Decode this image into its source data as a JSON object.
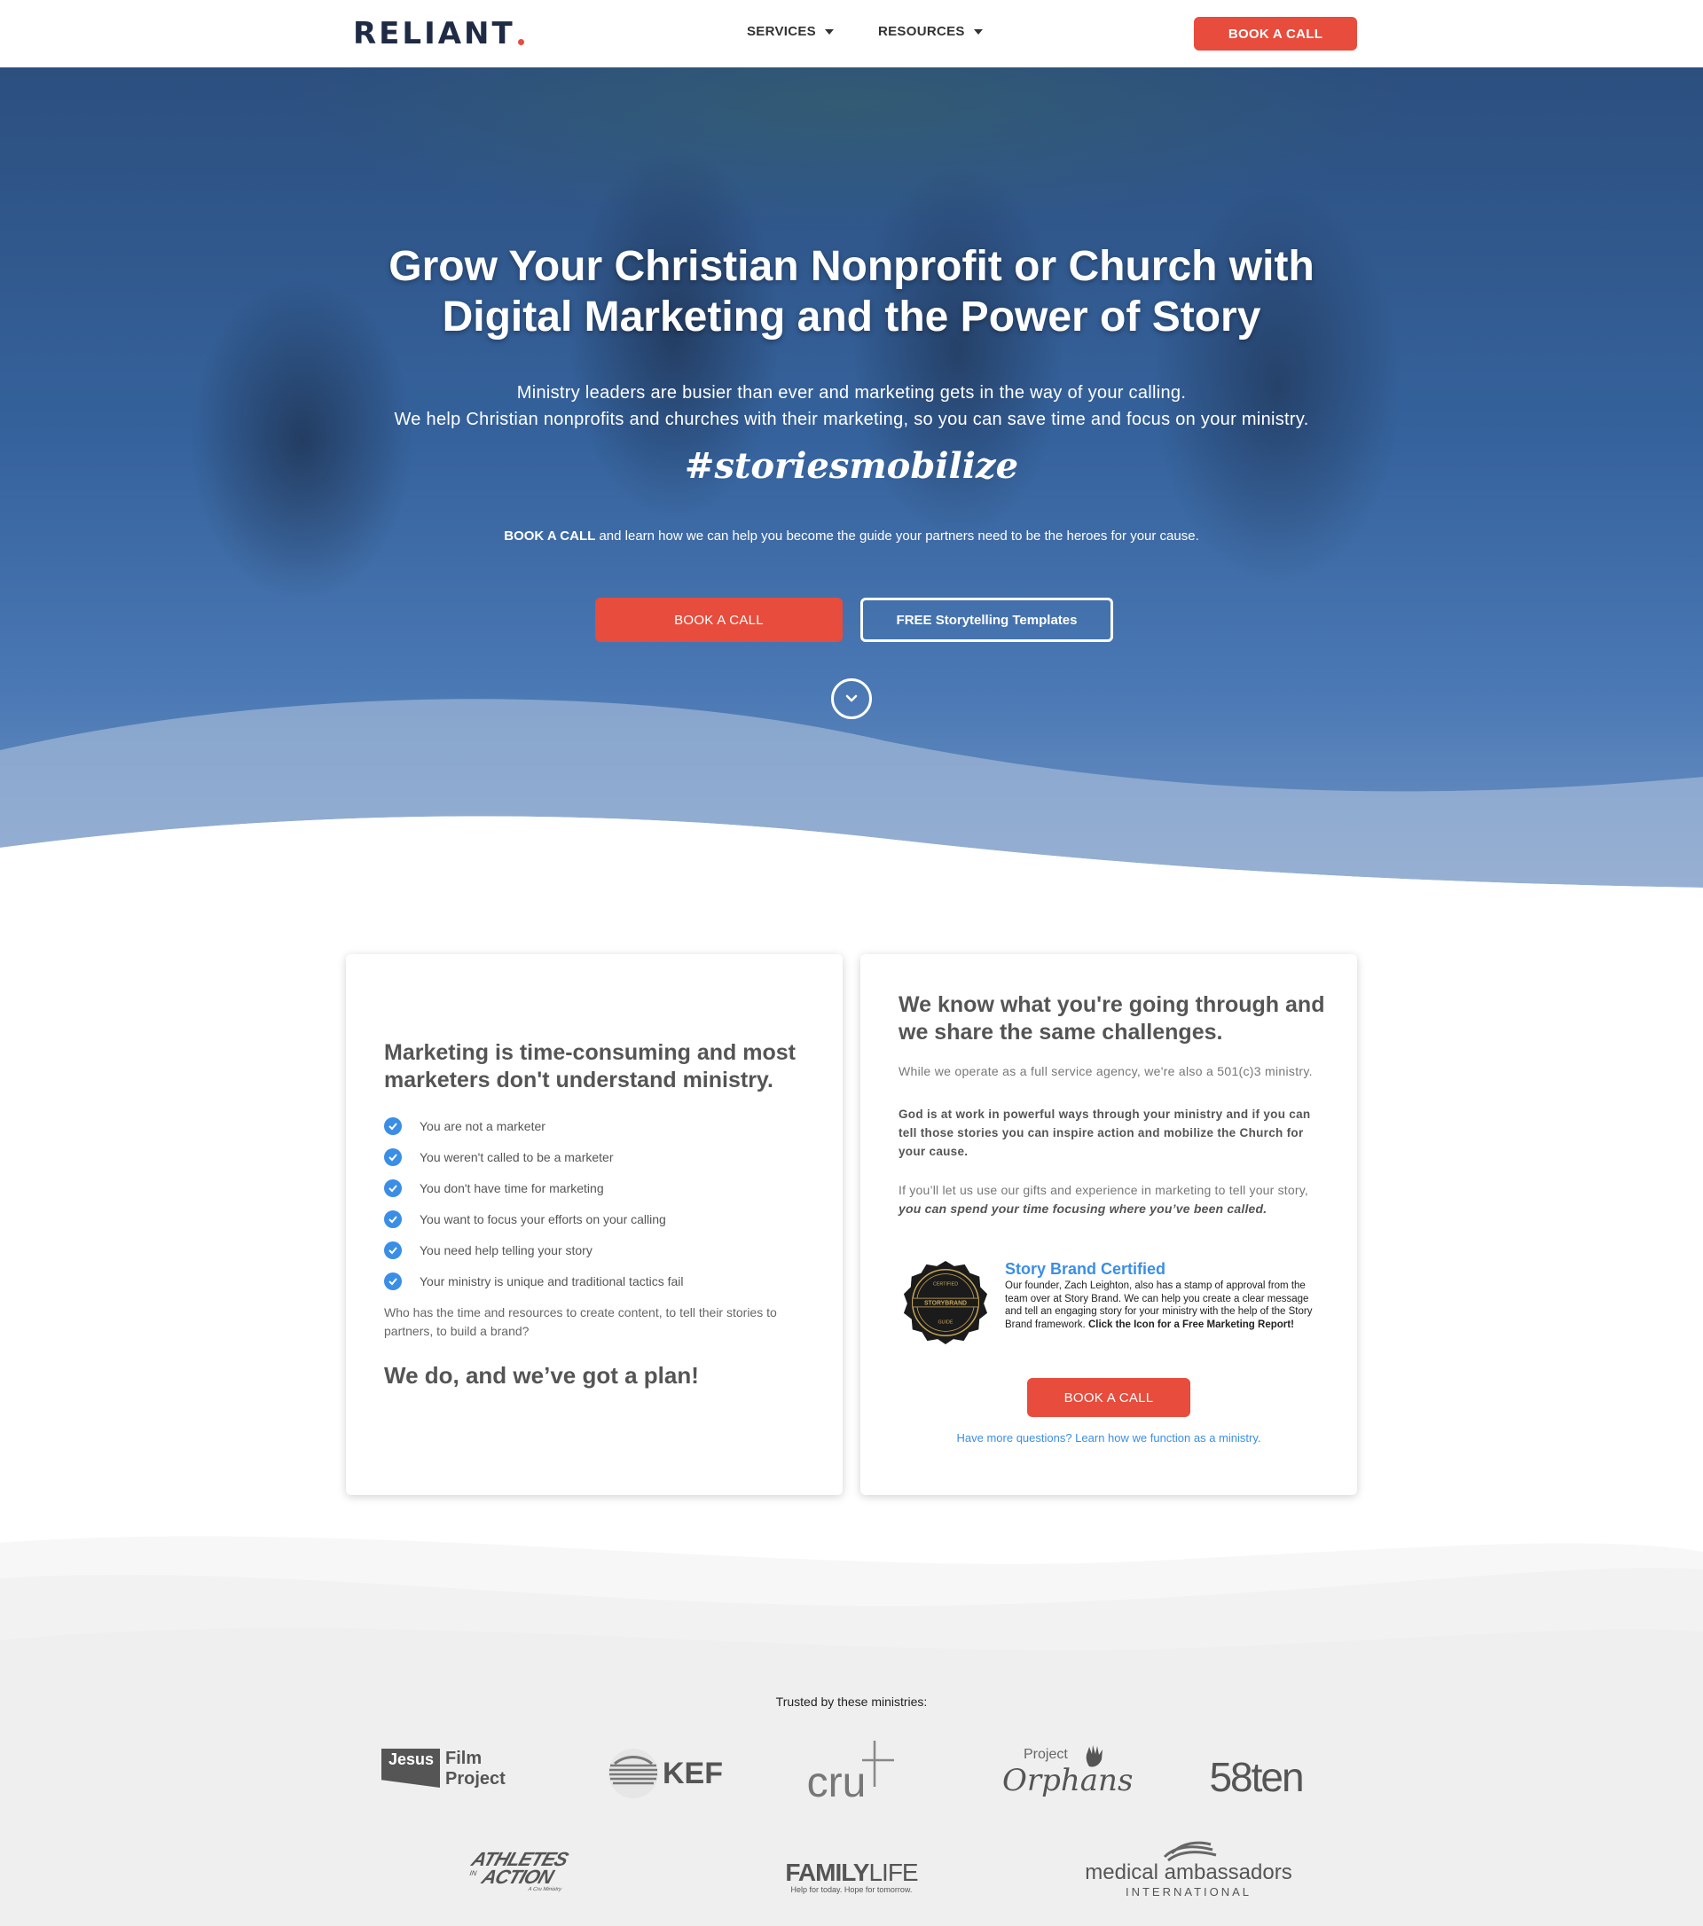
{
  "nav": {
    "brand": "RELIANT",
    "services": "SERVICES",
    "resources": "RESOURCES",
    "book_call": "BOOK A CALL"
  },
  "hero": {
    "title_line1": "Grow Your Christian Nonprofit or Church with",
    "title_line2": "Digital Marketing and the Power of Story",
    "sub_line1": "Ministry leaders are busier than ever and marketing gets in the way of your calling.",
    "sub_line2": "We help Christian nonprofits and churches with their marketing, so you can save time and focus on your ministry.",
    "hashtag": "#storiesmobilize",
    "cta_bold": "BOOK A CALL",
    "cta_rest": " and learn how we can help you become the guide your partners need to be the heroes for your cause.",
    "btn_primary": "BOOK A CALL",
    "btn_secondary": "FREE Storytelling Templates"
  },
  "left_card": {
    "title": "Marketing is time-consuming and most marketers don't understand ministry.",
    "items": [
      "You are not a marketer",
      "You weren't called to be a marketer",
      "You don't have time for marketing",
      "You want to focus your efforts on your calling",
      "You need help telling your story",
      "Your ministry is unique and traditional tactics fail"
    ],
    "paragraph": "Who has the time and resources to create content, to tell their stories to partners, to build a brand?",
    "plan": "We do, and we’ve got a plan!"
  },
  "right_card": {
    "title": "We know what you're going through and we share the same challenges.",
    "p1": "While we operate as a full service agency, we're also a 501(c)3 ministry.",
    "p2": "God is at work in powerful ways through your ministry and if you can tell those stories you can inspire action and mobilize the Church for your cause.",
    "p3_start": "If you’ll let us use our gifts and experience in marketing to tell your story, ",
    "p3_emph": "you can spend your time focusing where you’ve been called.",
    "badge_top": "CERTIFIED",
    "badge_mid": "STORYBRAND",
    "badge_bottom": "GUIDE",
    "sb_title": "Story Brand Certified",
    "sb_text": "Our founder, Zach Leighton, also has a stamp of approval from the team over at Story Brand. We can help you create a clear message and tell an engaging story for your ministry with the help of the Story Brand framework. ",
    "sb_bold": "Click the Icon for a Free Marketing Report!",
    "btn": "BOOK A CALL",
    "link": "Have more questions? Learn how we function as a ministry."
  },
  "trusted": {
    "title": "Trusted by these ministries:",
    "jesus_a": "Jesus",
    "jesus_b": "Film",
    "jesus_c": "Project",
    "kef": "KEF",
    "cru": "cru",
    "orphans_a": "Project",
    "orphans_b": "Orphans",
    "fiftyeight": "58ten",
    "aia_a": "ATHLETES",
    "aia_b": "IN",
    "aia_c": "ACTION",
    "aia_d": "A Cru Ministry",
    "familylife_a": "FAMILY",
    "familylife_b": "LIFE",
    "familylife_c": "Help for today. Hope for tomorrow.",
    "ma_a": "medical ambassadors",
    "ma_b": "INTERNATIONAL"
  },
  "colors": {
    "accent": "#e74c3c",
    "brand_dark": "#1f2b45",
    "link_blue": "#3a8ee6",
    "hero_blue": "#35629c"
  }
}
